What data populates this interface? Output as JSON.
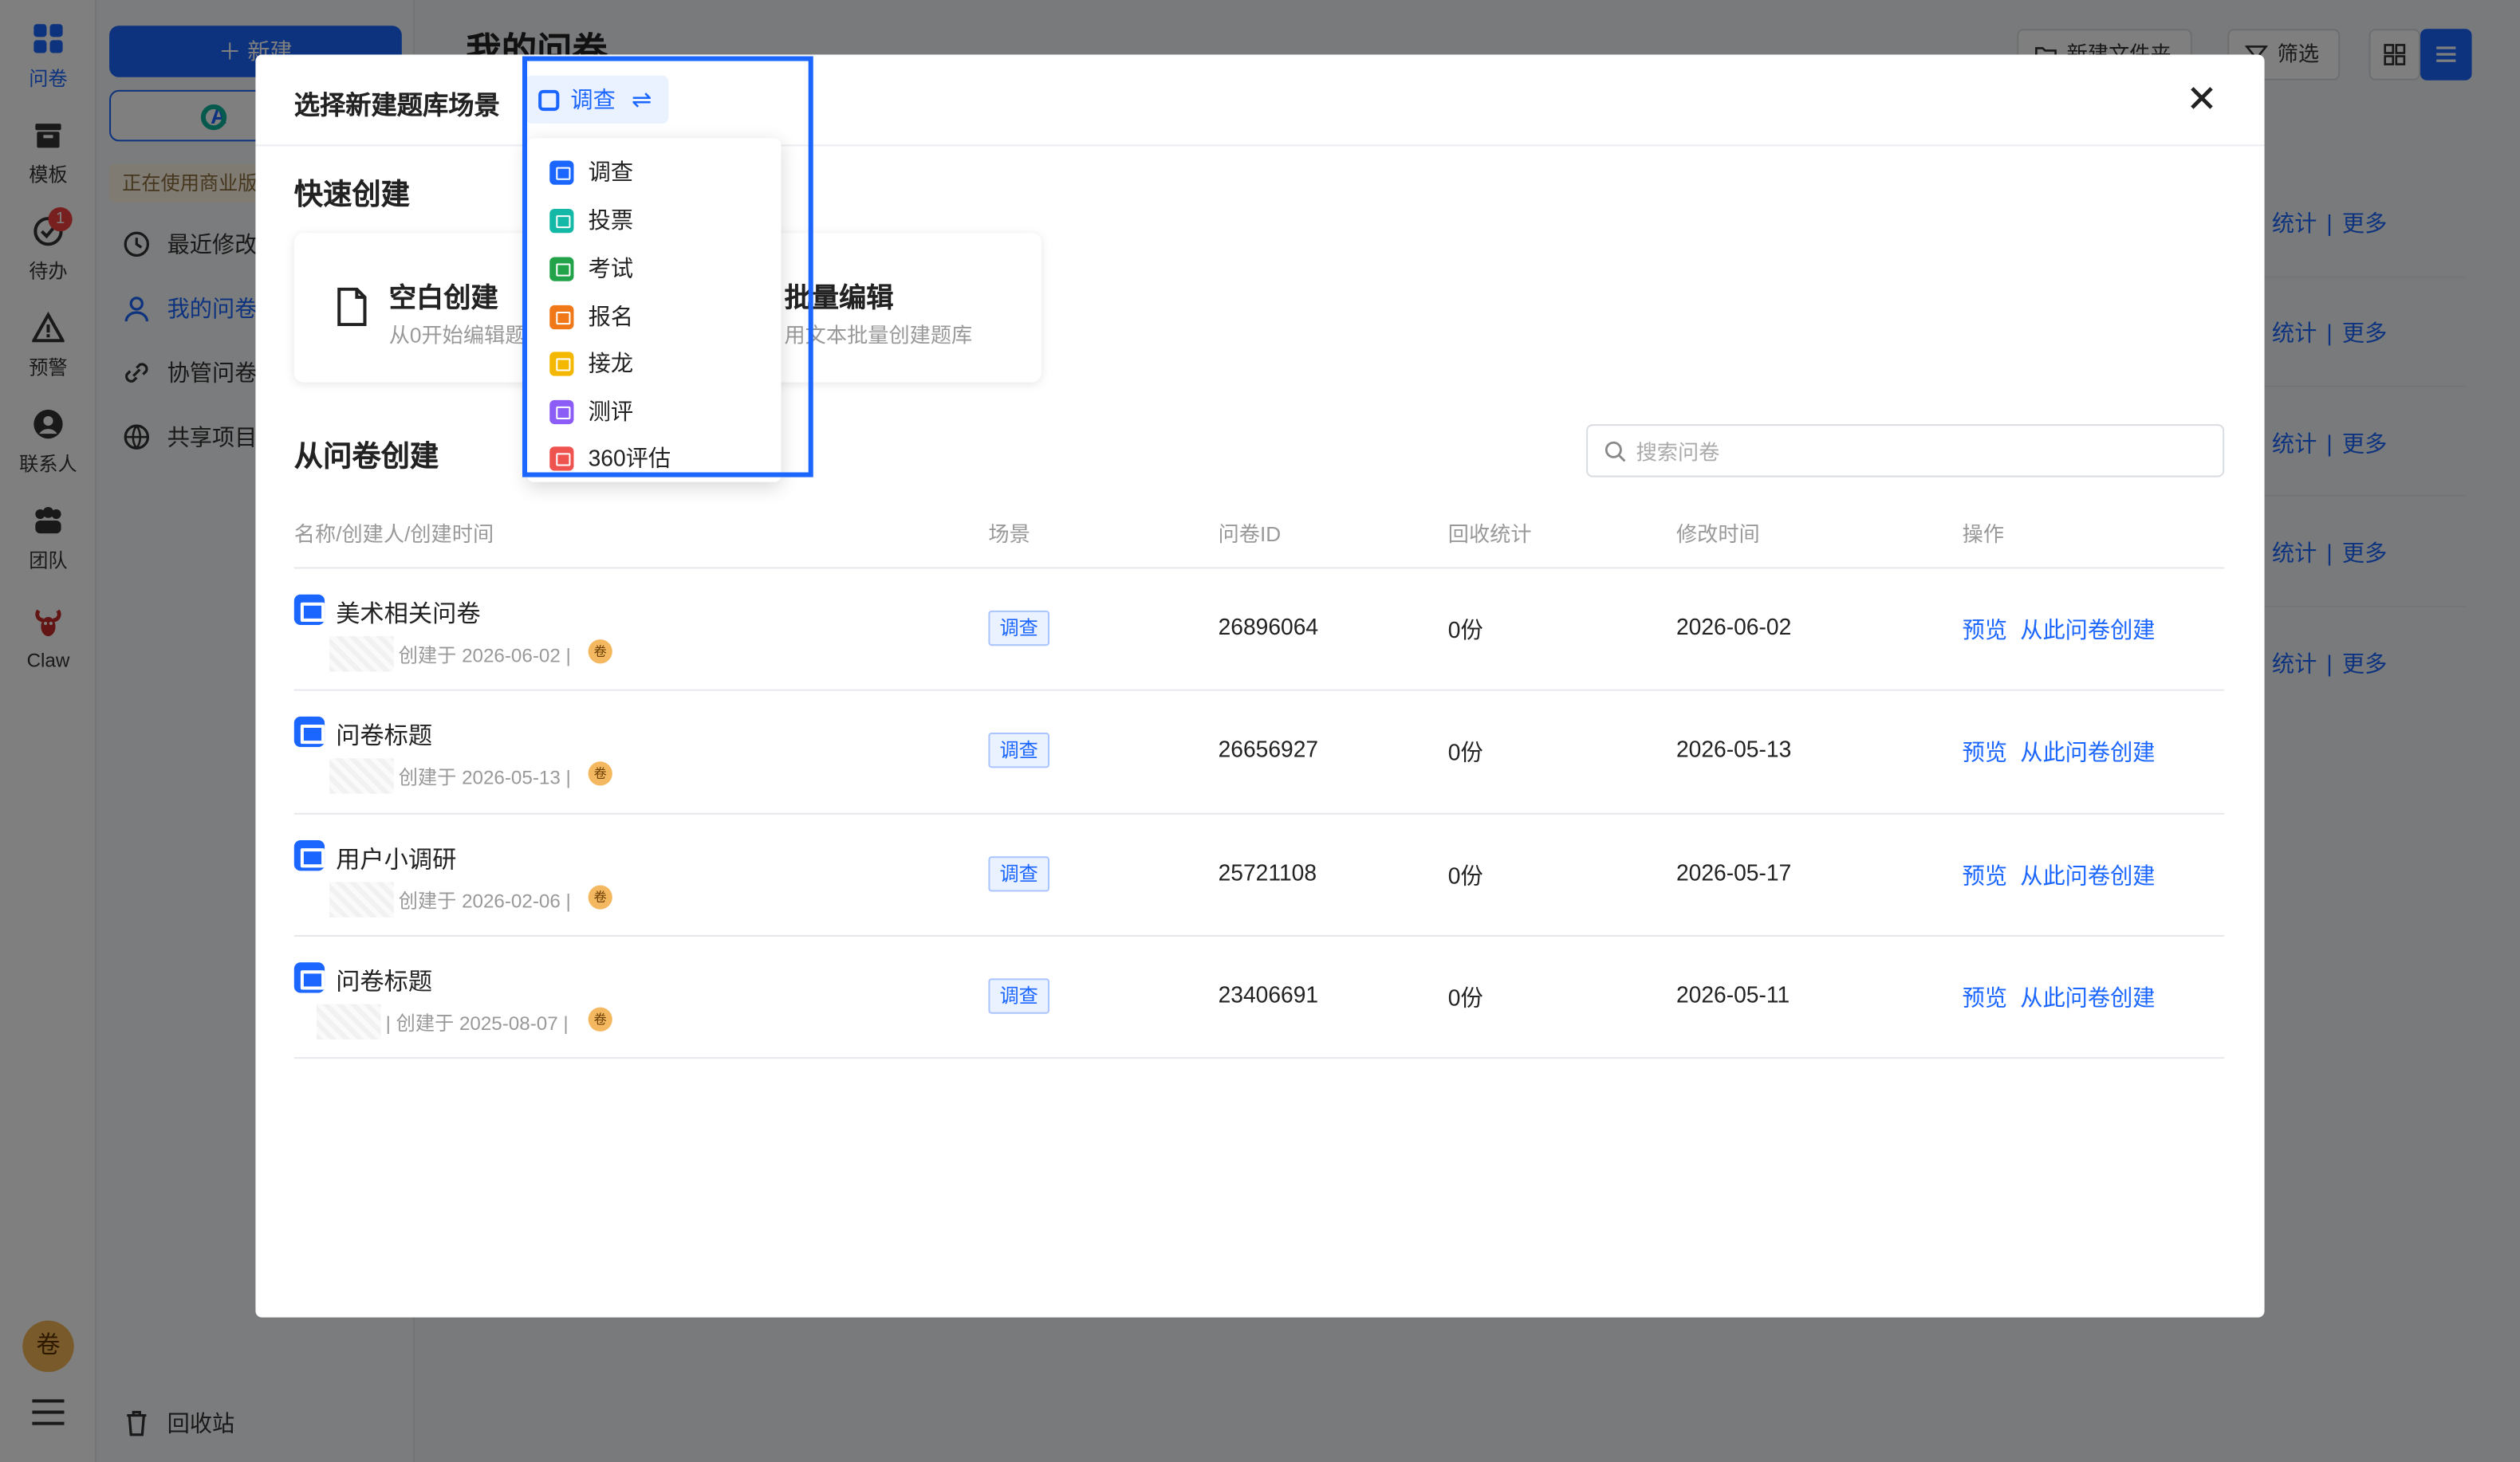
{
  "rail": {
    "items": [
      {
        "label": "问卷"
      },
      {
        "label": "模板"
      },
      {
        "label": "待办",
        "badge": "1"
      },
      {
        "label": "预警"
      },
      {
        "label": "联系人"
      },
      {
        "label": "团队"
      },
      {
        "label": "Claw"
      }
    ],
    "avatar_text": "卷"
  },
  "sidenav": {
    "new_button": "＋ 新建",
    "ai_button": "A",
    "notice": "正在使用商业版",
    "items": [
      {
        "label": "最近修改"
      },
      {
        "label": "我的问卷"
      },
      {
        "label": "协管问卷"
      },
      {
        "label": "共享项目"
      }
    ],
    "recycle": "回收站"
  },
  "main": {
    "title": "我的问卷",
    "new_folder": "新建文件夹",
    "filter": "筛选",
    "row_actions": {
      "stats": "统计",
      "more": "更多",
      "sep": "|"
    }
  },
  "modal": {
    "title": "选择新建题库场景",
    "scene_current": "调查",
    "scene_swap_icon": "⇌",
    "quick_create": "快速创建",
    "cards": [
      {
        "title": "空白创建",
        "subtitle": "从0开始编辑题"
      },
      {
        "title": "批量编辑",
        "subtitle": "用文本批量创建题库"
      }
    ],
    "from_survey": "从问卷创建",
    "search_placeholder": "搜索问卷",
    "columns": [
      "名称/创建人/创建时间",
      "场景",
      "问卷ID",
      "回收统计",
      "修改时间",
      "操作"
    ],
    "rows": [
      {
        "name": "美术相关问卷",
        "meta": "创建于 2026-06-02 |",
        "scene": "调查",
        "id": "26896064",
        "count": "0份",
        "modified": "2026-06-02",
        "preview": "预览",
        "create": "从此问卷创建"
      },
      {
        "name": "问卷标题",
        "meta": "创建于 2026-05-13 |",
        "scene": "调查",
        "id": "26656927",
        "count": "0份",
        "modified": "2026-05-13",
        "preview": "预览",
        "create": "从此问卷创建"
      },
      {
        "name": "用户小调研",
        "meta": "创建于 2026-02-06 |",
        "scene": "调查",
        "id": "25721108",
        "count": "0份",
        "modified": "2026-05-17",
        "preview": "预览",
        "create": "从此问卷创建"
      },
      {
        "name": "问卷标题",
        "meta": "| 创建于 2025-08-07 |",
        "scene": "调查",
        "id": "23406691",
        "count": "0份",
        "modified": "2026-05-11",
        "preview": "预览",
        "create": "从此问卷创建"
      }
    ],
    "mini_avatar": "卷"
  },
  "dropdown": {
    "items": [
      {
        "label": "调查",
        "color": "#1a66ff"
      },
      {
        "label": "投票",
        "color": "#14b8a6"
      },
      {
        "label": "考试",
        "color": "#22a34a"
      },
      {
        "label": "报名",
        "color": "#f07818"
      },
      {
        "label": "接龙",
        "color": "#f5b800"
      },
      {
        "label": "测评",
        "color": "#8b5cf6"
      },
      {
        "label": "360评估",
        "color": "#ef5350"
      }
    ]
  },
  "colors": {
    "accent": "#1a66ff",
    "highlight_border": "#1a66ff"
  }
}
